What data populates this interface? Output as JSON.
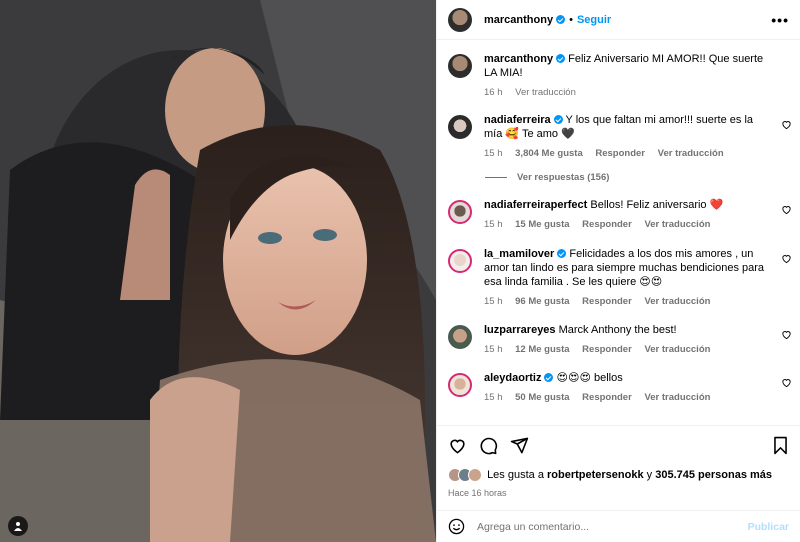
{
  "post": {
    "author": "marcanthony",
    "follow_label": "Seguir",
    "dot": "•",
    "more_icon": "more-icon",
    "caption": "Feliz Aniversario MI AMOR!! Que suerte LA MIA!",
    "caption_time": "16 h",
    "caption_translate": "Ver traducción"
  },
  "comments": [
    {
      "user": "nadiaferreira",
      "verified": true,
      "text": "Y los que faltan mi amor!!! suerte es la mía 🥰 Te amo 🖤",
      "time": "15 h",
      "likes": "3,804 Me gusta",
      "reply": "Responder",
      "translate": "Ver traducción"
    },
    {
      "user": "nadiaferreiraperfect",
      "verified": false,
      "text": "Bellos! Feliz aniversario ❤️",
      "time": "15 h",
      "likes": "15 Me gusta",
      "reply": "Responder",
      "translate": "Ver traducción"
    },
    {
      "user": "la_mamilover",
      "verified": true,
      "text": "Felicidades a los dos mis amores , un amor tan lindo es para siempre muchas bendiciones para esa linda familia . Se les quiere 😍😍",
      "time": "15 h",
      "likes": "96 Me gusta",
      "reply": "Responder",
      "translate": "Ver traducción"
    },
    {
      "user": "luzparrareyes",
      "verified": false,
      "text": "Marck Anthony the best!",
      "time": "15 h",
      "likes": "12 Me gusta",
      "reply": "Responder",
      "translate": "Ver traducción"
    },
    {
      "user": "aleydaortiz",
      "verified": true,
      "text": "😍😍😍 bellos",
      "time": "15 h",
      "likes": "50 Me gusta",
      "reply": "Responder",
      "translate": "Ver traducción"
    }
  ],
  "replies_label": "Ver respuestas (156)",
  "likes": {
    "prefix": "Les gusta a",
    "user": "robertpetersenokk",
    "joiner": "y",
    "others": "305.745 personas más"
  },
  "posted_ago": "Hace 16 horas",
  "add_comment": {
    "placeholder": "Agrega un comentario...",
    "publish": "Publicar"
  },
  "colors": {
    "accent": "#0095f6",
    "muted": "#737373",
    "publish_disabled": "#b2dffc"
  }
}
